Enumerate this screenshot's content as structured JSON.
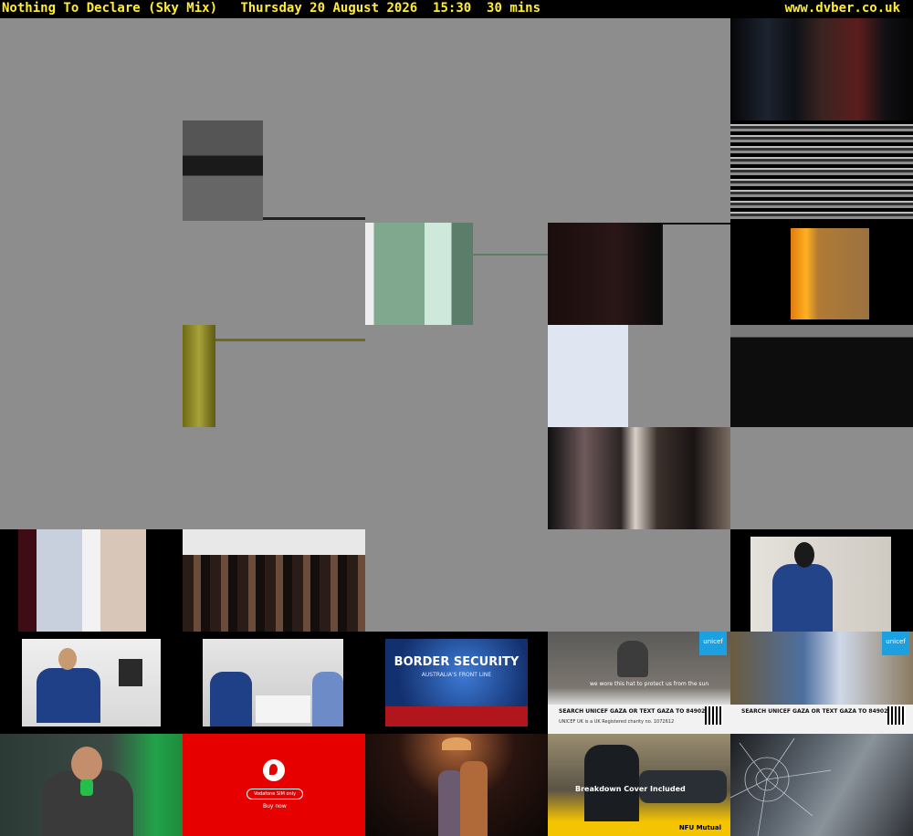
{
  "header": {
    "programme": "Nothing To Declare (Sky Mix)",
    "schedule": "Thursday 20 August 2026  15:30  30 mins",
    "site": "www.dvber.co.uk"
  },
  "thumbnails": {
    "unicef_1": {
      "caption": "we wore this hat to protect us from the sun",
      "cta": "SEARCH UNICEF GAZA OR TEXT GAZA TO 84902",
      "footer": "UNICEF UK is a UK Registered charity no. 1072612",
      "brand": "unicef"
    },
    "unicef_2": {
      "cta": "SEARCH UNICEF GAZA OR TEXT GAZA TO 84902",
      "brand": "unicef"
    },
    "border_security": {
      "title": "BORDER SECURITY",
      "subtitle": "AUSTRALIA'S FRONT LINE"
    },
    "vodafone": {
      "pill": "Vodafone SIM only",
      "cta": "Buy now"
    },
    "nfu": {
      "headline": "Breakdown Cover Included",
      "brand": "NFU Mutual"
    }
  },
  "colors": {
    "header_text": "#ffee33",
    "gray_frame": "#8d8d8d",
    "vodafone_red": "#e60000",
    "unicef_blue": "#1ca0e0",
    "border_blue": "#1a3f8f",
    "nfu_yellow": "#f5c400"
  }
}
